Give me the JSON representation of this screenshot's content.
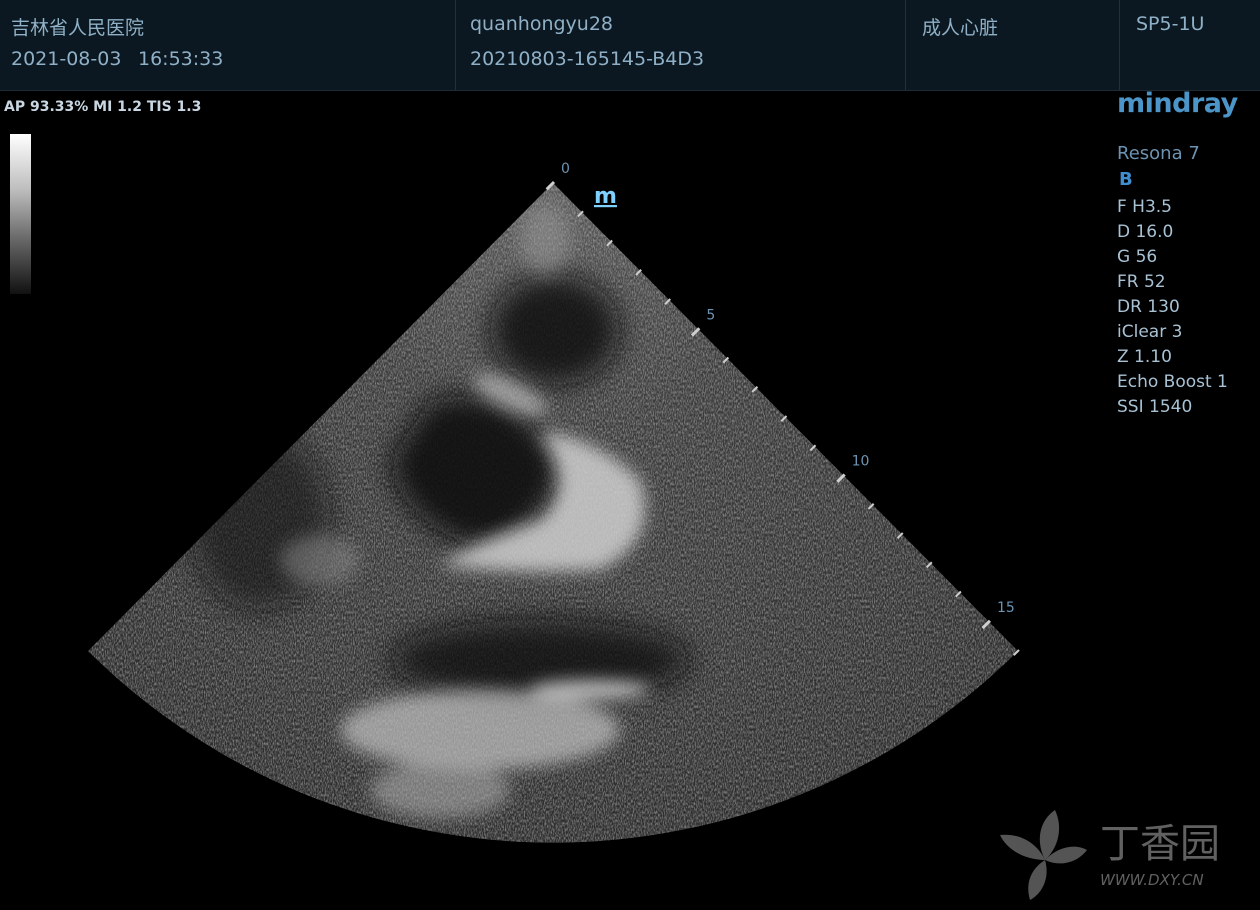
{
  "header": {
    "hospital": "吉林省人民医院",
    "date": "2021-08-03",
    "time": "16:53:33",
    "operator": "quanhongyu28",
    "exam_id": "20210803-165145-B4D3",
    "preset": "成人心脏",
    "probe": "SP5-1U"
  },
  "power_readout": "AP 93.33%  MI 1.2  TIS 1.3",
  "brand": "mindray",
  "system": {
    "model": "Resona 7",
    "mode": "B",
    "params": [
      "F H3.5",
      "D 16.0",
      "G 56",
      "FR 52",
      "DR 130",
      "iClear 3",
      "Z 1.10",
      "Echo Boost 1",
      "SSI 1540"
    ]
  },
  "depth_scale": {
    "labels": [
      "0",
      "5",
      "10",
      "15"
    ],
    "max_cm": 16,
    "marker": "m"
  },
  "watermark": {
    "name": "丁香园",
    "url": "WWW.DXY.CN"
  },
  "colors": {
    "header_bg": "#0b1821",
    "header_text": "#8fb0c6",
    "accent_blue": "#4c95c8",
    "tick_blue": "#6d93b2"
  }
}
